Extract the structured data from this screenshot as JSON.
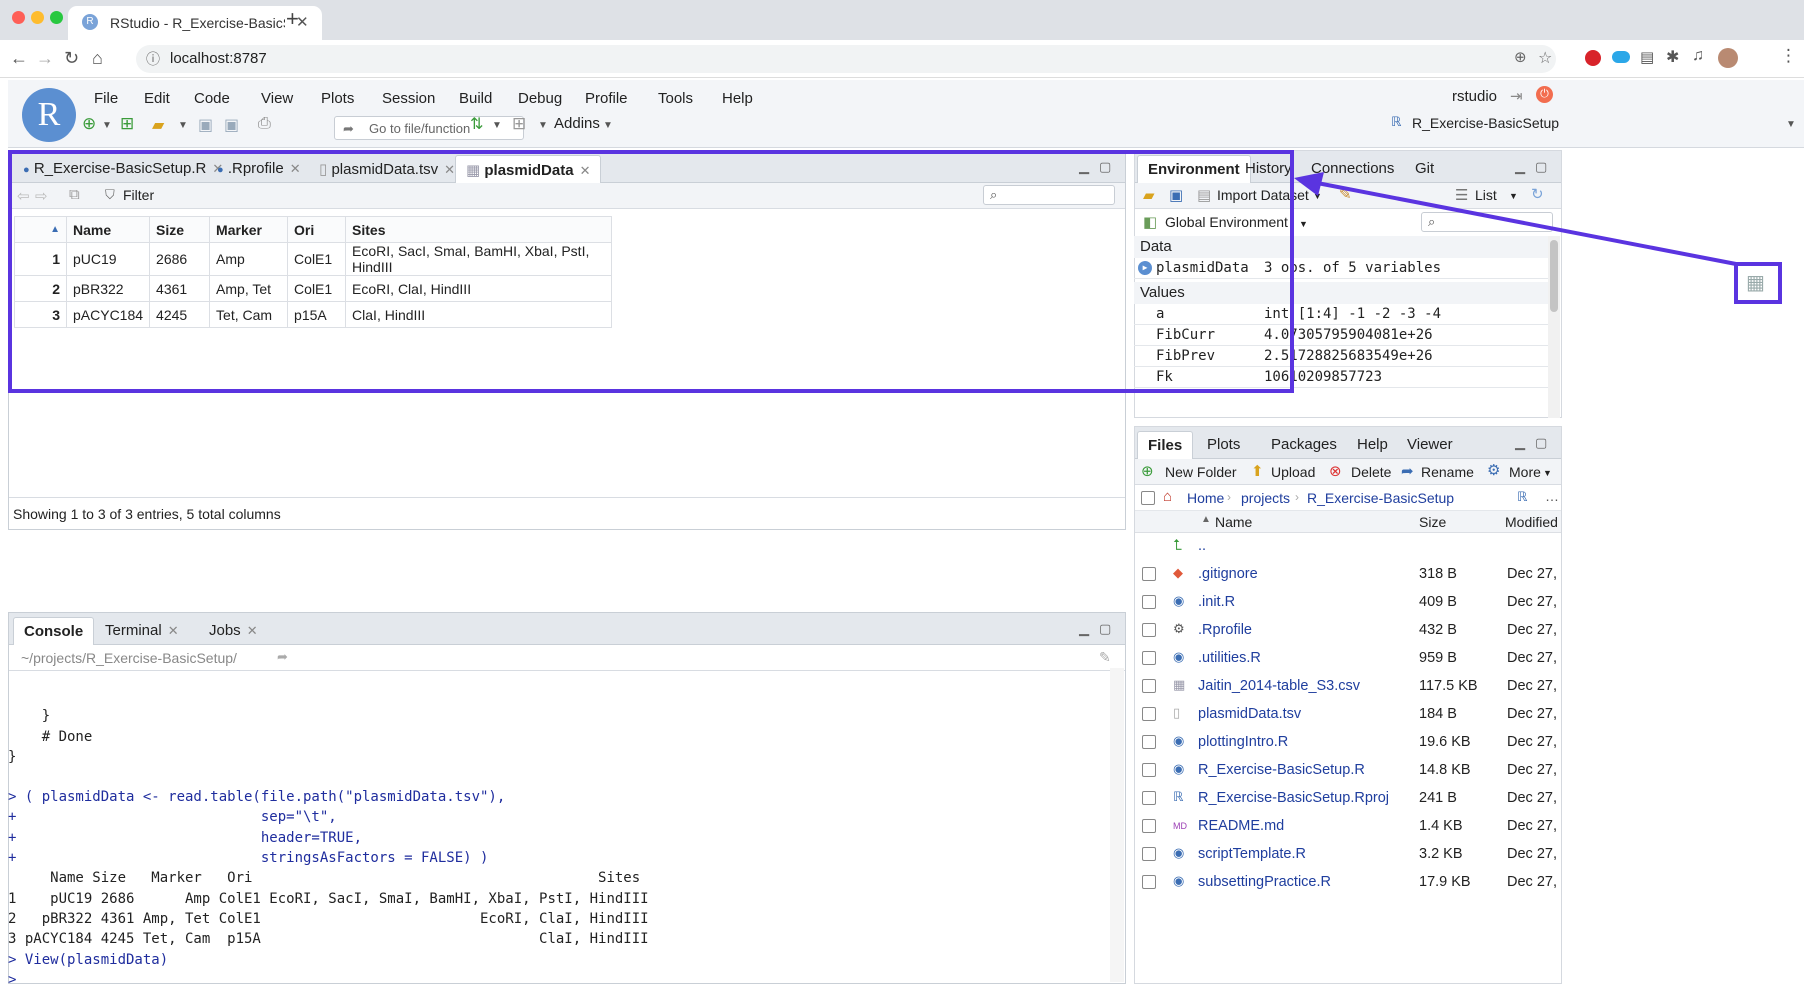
{
  "browser": {
    "tab_title": "RStudio - R_Exercise-BasicSet",
    "url": "localhost:8787"
  },
  "rstudio": {
    "logo": "R",
    "menu": [
      "File",
      "Edit",
      "Code",
      "View",
      "Plots",
      "Session",
      "Build",
      "Debug",
      "Profile",
      "Tools",
      "Help"
    ],
    "goto_placeholder": "Go to file/function",
    "addins": "Addins",
    "user": "rstudio",
    "project": "R_Exercise-BasicSetup"
  },
  "source": {
    "tabs": [
      "R_Exercise-BasicSetup.R",
      ".Rprofile",
      "plasmidData.tsv",
      "plasmidData"
    ],
    "filter_label": "Filter",
    "columns": [
      "Name",
      "Size",
      "Marker",
      "Ori",
      "Sites"
    ],
    "rows": [
      [
        "1",
        "pUC19",
        "2686",
        "Amp",
        "ColE1",
        "EcoRI, SacI, SmaI, BamHI, XbaI, PstI, HindIII"
      ],
      [
        "2",
        "pBR322",
        "4361",
        "Amp, Tet",
        "ColE1",
        "EcoRI, ClaI, HindIII"
      ],
      [
        "3",
        "pACYC184",
        "4245",
        "Tet, Cam",
        "p15A",
        "ClaI, HindIII"
      ]
    ],
    "status": "Showing 1 to 3 of 3 entries, 5 total columns"
  },
  "console": {
    "tabs": [
      "Console",
      "Terminal",
      "Jobs"
    ],
    "path": "~/projects/R_Exercise-BasicSetup/",
    "lines_plain": [
      "    }",
      "    # Done",
      "}"
    ],
    "lines_cmd": [
      "> ( plasmidData <- read.table(file.path(\"plasmidData.tsv\"),",
      "+                             sep=\"\\t\",",
      "+                             header=TRUE,",
      "+                             stringsAsFactors = FALSE) )"
    ],
    "output": [
      "     Name Size   Marker   Ori                                         Sites",
      "1    pUC19 2686      Amp ColE1 EcoRI, SacI, SmaI, BamHI, XbaI, PstI, HindIII",
      "2   pBR322 4361 Amp, Tet ColE1                          EcoRI, ClaI, HindIII",
      "3 pACYC184 4245 Tet, Cam  p15A                                 ClaI, HindIII"
    ],
    "last_cmd": "> View(plasmidData)",
    "prompt": ">"
  },
  "environment": {
    "tabs": [
      "Environment",
      "History",
      "Connections",
      "Git"
    ],
    "import_label": "Import Dataset",
    "list_label": "List",
    "scope": "Global Environment",
    "data_header": "Data",
    "values_header": "Values",
    "data": [
      {
        "name": "plasmidData",
        "value": "3 obs. of 5 variables"
      }
    ],
    "values": [
      {
        "name": "a",
        "value": "int [1:4] -1 -2 -3 -4"
      },
      {
        "name": "FibCurr",
        "value": "4.07305795904081e+26"
      },
      {
        "name": "FibPrev",
        "value": "2.51728825683549e+26"
      },
      {
        "name": "Fk",
        "value": "10610209857723"
      }
    ]
  },
  "files": {
    "tabs": [
      "Files",
      "Plots",
      "Packages",
      "Help",
      "Viewer"
    ],
    "toolbar": [
      "New Folder",
      "Upload",
      "Delete",
      "Rename",
      "More"
    ],
    "breadcrumb": [
      "Home",
      "projects",
      "R_Exercise-BasicSetup"
    ],
    "columns": [
      "Name",
      "Size",
      "Modified"
    ],
    "up": "..",
    "items": [
      {
        "name": ".gitignore",
        "size": "318 B",
        "modified": "Dec 27,"
      },
      {
        "name": ".init.R",
        "size": "409 B",
        "modified": "Dec 27,"
      },
      {
        "name": ".Rprofile",
        "size": "432 B",
        "modified": "Dec 27,"
      },
      {
        "name": ".utilities.R",
        "size": "959 B",
        "modified": "Dec 27,"
      },
      {
        "name": "Jaitin_2014-table_S3.csv",
        "size": "117.5 KB",
        "modified": "Dec 27,"
      },
      {
        "name": "plasmidData.tsv",
        "size": "184 B",
        "modified": "Dec 27,"
      },
      {
        "name": "plottingIntro.R",
        "size": "19.6 KB",
        "modified": "Dec 27,"
      },
      {
        "name": "R_Exercise-BasicSetup.R",
        "size": "14.8 KB",
        "modified": "Dec 27,"
      },
      {
        "name": "R_Exercise-BasicSetup.Rproj",
        "size": "241 B",
        "modified": "Dec 27,"
      },
      {
        "name": "README.md",
        "size": "1.4 KB",
        "modified": "Dec 27,"
      },
      {
        "name": "scriptTemplate.R",
        "size": "3.2 KB",
        "modified": "Dec 27,"
      },
      {
        "name": "subsettingPractice.R",
        "size": "17.9 KB",
        "modified": "Dec 27,"
      }
    ]
  },
  "colors": {
    "highlight": "#5a34e0",
    "link": "#1f3e9e",
    "rlogo": "#5b8fd1"
  }
}
